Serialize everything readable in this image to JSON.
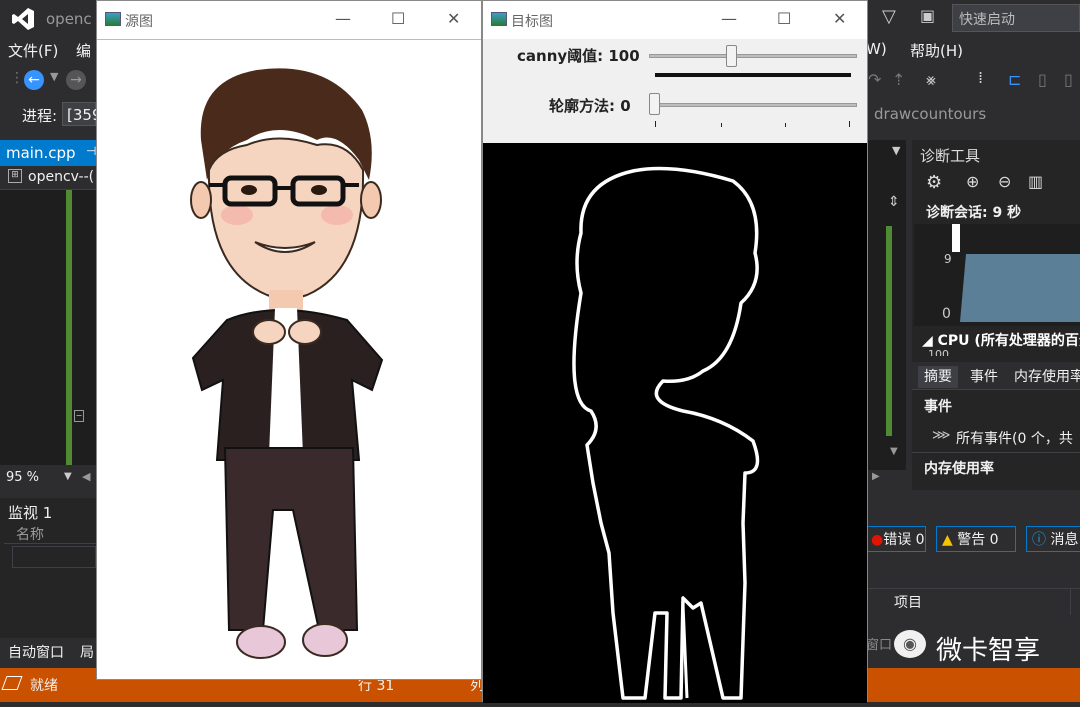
{
  "ide": {
    "title_fragment": "openc",
    "quick_launch": "快速启动",
    "menu": [
      "文件(F)",
      "编",
      "W)",
      "帮助(H)"
    ],
    "process_label": "进程:",
    "process_value": "[359",
    "function_dropdown": "drawcountours",
    "file_tab": "main.cpp",
    "project_dropdown": "opencv--(",
    "zoom": "95 %",
    "watch_title": "监视 1",
    "watch_col_name": "名称",
    "bottom_tab_auto": "自动窗口",
    "bottom_tab_local": "局",
    "status_ready": "就绪",
    "status_line": "行 31",
    "status_col": "列",
    "diag_title": "诊断工具",
    "diag_session": "诊断会话: 9 秒",
    "diag_axis_top": "9",
    "diag_axis_zero": "0",
    "cpu_header": "CPU (所有处理器的百分",
    "cpu_axis": "100",
    "diag_tabs": [
      "摘要",
      "事件",
      "内存使用率"
    ],
    "events_header": "事件",
    "events_all": "所有事件(0 个，共",
    "memory_header": "内存使用率",
    "errors_label": "错误 0",
    "warnings_label": "警告 0",
    "messages_label": "消息",
    "project_col": "项目",
    "watermark": "微卡智享",
    "window_label_fragment": "窗口"
  },
  "source_window": {
    "title": "源图"
  },
  "target_window": {
    "title": "目标图",
    "trackbar1_label": "canny阈值: 100",
    "trackbar1_value": 100,
    "trackbar2_label": "轮廓方法: 0",
    "trackbar2_value": 0
  },
  "colors": {
    "ide_bg": "#2d2d30",
    "status": "#ca5100",
    "accent": "#007acc",
    "green_margin": "#508a32"
  }
}
